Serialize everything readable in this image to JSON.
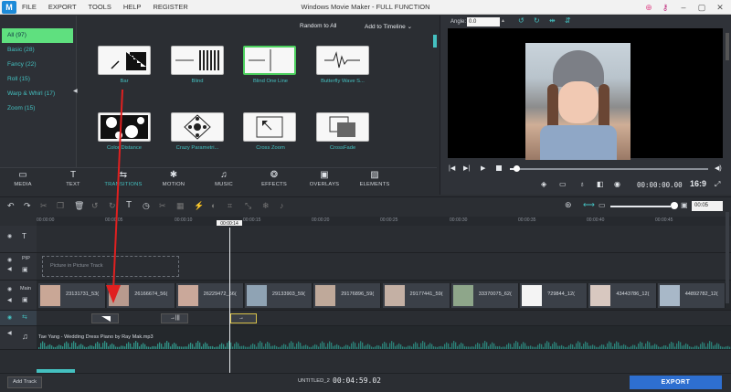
{
  "app": {
    "title": "Windows Movie Maker - FULL FUNCTION",
    "logo_text": "M",
    "menu": [
      "FILE",
      "EXPORT",
      "TOOLS",
      "HELP",
      "REGISTER"
    ]
  },
  "library": {
    "categories": [
      {
        "label": "All (97)",
        "active": true
      },
      {
        "label": "Basic (28)",
        "active": false
      },
      {
        "label": "Fancy (22)",
        "active": false
      },
      {
        "label": "Roll (15)",
        "active": false
      },
      {
        "label": "Warp & Whirl (17)",
        "active": false
      },
      {
        "label": "Zoom (15)",
        "active": false
      }
    ],
    "random_label": "Random to All",
    "add_timeline_label": "Add to Timeline",
    "transitions": [
      {
        "label": "Bar",
        "selected": false
      },
      {
        "label": "Blind",
        "selected": false
      },
      {
        "label": "Blind One Line",
        "selected": true
      },
      {
        "label": "Butterfly Wave S...",
        "selected": false
      },
      {
        "label": "Color Distance",
        "selected": false
      },
      {
        "label": "Crazy Parametri...",
        "selected": false
      },
      {
        "label": "Cross Zoom",
        "selected": false
      },
      {
        "label": "CrossFade",
        "selected": false
      }
    ]
  },
  "tabs": [
    {
      "label": "MEDIA",
      "icon": "folder-icon",
      "glyph": "▭",
      "active": false
    },
    {
      "label": "TEXT",
      "icon": "text-icon",
      "glyph": "T",
      "active": false
    },
    {
      "label": "TRANSITIONS",
      "icon": "transitions-icon",
      "glyph": "⇆",
      "active": true
    },
    {
      "label": "MOTION",
      "icon": "motion-icon",
      "glyph": "✱",
      "active": false
    },
    {
      "label": "MUSIC",
      "icon": "music-icon",
      "glyph": "♫",
      "active": false
    },
    {
      "label": "EFFECTS",
      "icon": "effects-icon",
      "glyph": "❂",
      "active": false
    },
    {
      "label": "OVERLAYS",
      "icon": "overlays-icon",
      "glyph": "▣",
      "active": false
    },
    {
      "label": "ELEMENTS",
      "icon": "elements-icon",
      "glyph": "▨",
      "active": false
    }
  ],
  "preview": {
    "angle_label": "Angle:",
    "angle_value": "0.0",
    "timecode": "00:00:00.00",
    "aspect": "16:9",
    "progress": 0.03
  },
  "timeline": {
    "zoom_value": "00:05",
    "playhead_label": "00:00:14",
    "ruler_ticks": [
      "00:00:00",
      "00:00:05",
      "00:00:10",
      "00:00:15",
      "00:00:20",
      "00:00:25",
      "00:00:30",
      "00:00:35",
      "00:00:40",
      "00:00:45"
    ],
    "pip_placeholder": "Picture in Picture Track",
    "track_labels": {
      "pip": "PIP",
      "main": "Main"
    },
    "clips": [
      {
        "name": "23131731_53("
      },
      {
        "name": "26166674_56("
      },
      {
        "name": "26229472_56("
      },
      {
        "name": "29133903_59("
      },
      {
        "name": "29176896_59("
      },
      {
        "name": "29177441_59("
      },
      {
        "name": "33370075_62("
      },
      {
        "name": "?29844_12("
      },
      {
        "name": "43443786_12("
      },
      {
        "name": "44892782_12("
      }
    ],
    "audio_label": "Tae Yang - Wedding Dress Piano by Ray Mak.mp3"
  },
  "footer": {
    "add_track": "Add Track",
    "project_name": "UNTITLED_2",
    "duration": "00:04:59.02",
    "export": "EXPORT"
  },
  "colors": {
    "accent": "#44c0c0",
    "export": "#2e6fd0",
    "selected_border": "#4cd05e",
    "annotation_arrow": "#e02020"
  }
}
